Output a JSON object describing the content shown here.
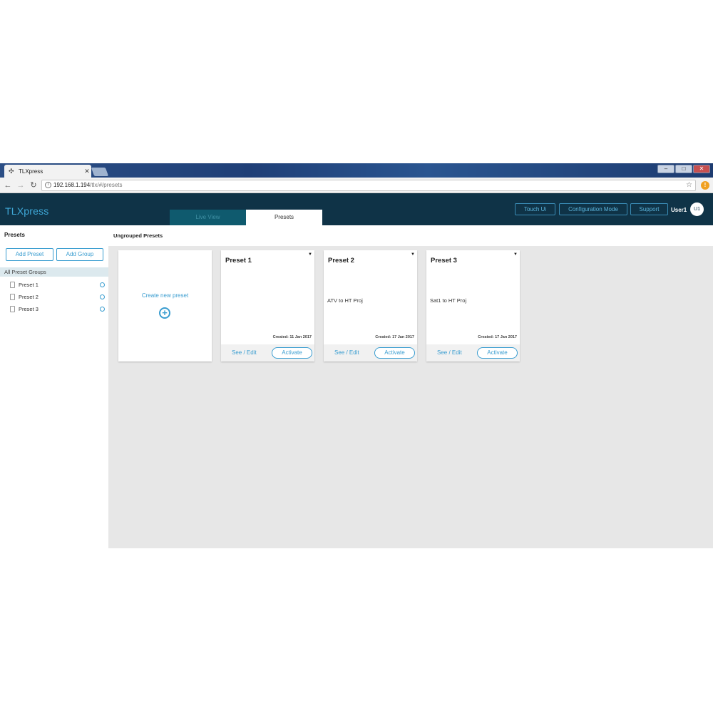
{
  "browser": {
    "tab_title": "TLXpress",
    "tab_close": "✕",
    "url_host": "192.168.1.194",
    "url_path": "/tlx/#/presets"
  },
  "header": {
    "brand": "TLXpress",
    "tabs": [
      {
        "label": "Live View"
      },
      {
        "label": "Presets"
      }
    ],
    "buttons": {
      "touch_ui": "Touch Ui",
      "configuration_mode": "Configuration Mode",
      "support": "Support"
    },
    "user": "User1",
    "avatar": "U1"
  },
  "sidebar": {
    "title": "Presets",
    "add_preset": "Add Preset",
    "add_group": "Add Group",
    "group_label": "All Preset Groups",
    "items": [
      {
        "label": "Preset 1"
      },
      {
        "label": "Preset 2"
      },
      {
        "label": "Preset 3"
      }
    ]
  },
  "main": {
    "section_title": "Ungrouped Presets",
    "create_label": "Create new preset",
    "cards": [
      {
        "title": "Preset 1",
        "description": "",
        "created": "Created: 11 Jan 2017",
        "see_edit": "See / Edit",
        "activate": "Activate"
      },
      {
        "title": "Preset 2",
        "description": "ATV to HT Proj",
        "created": "Created: 17 Jan 2017",
        "see_edit": "See / Edit",
        "activate": "Activate"
      },
      {
        "title": "Preset 3",
        "description": "Sat1 to HT Proj",
        "created": "Created: 17 Jan 2017",
        "see_edit": "See / Edit",
        "activate": "Activate"
      }
    ]
  },
  "colors": {
    "header_bg": "#0f3347",
    "accent": "#3a9dd0",
    "content_bg": "#e7e7e7"
  }
}
